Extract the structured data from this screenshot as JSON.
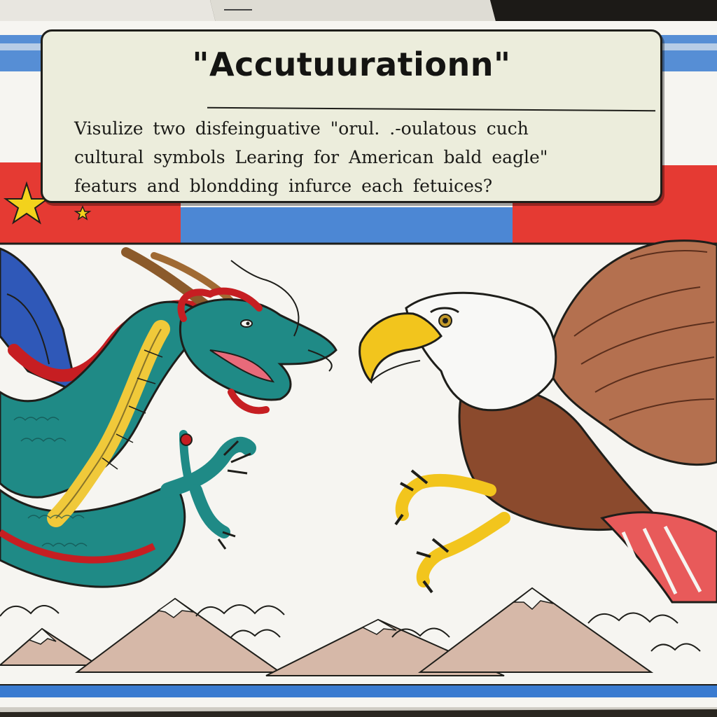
{
  "poster": {
    "title": "\"Accutuurationn\"",
    "lines": [
      "Visulize  two  disfeinguative   \"orul.  .-oulatous  cuch",
      "cultural symbols  Learing   for American  bald eagle\"",
      "featurs   and  blondding   infurce  each  fetuices?"
    ]
  },
  "colors": {
    "paper": "#f6f5f1",
    "flag_red": "#e53a33",
    "flag_blue": "#3a7bd0",
    "star_yellow": "#f3d21c",
    "dragon_teal": "#1f8a86",
    "dragon_belly": "#f0c93a",
    "eagle_brown": "#8b4a2d",
    "beak_yellow": "#f2c51d"
  },
  "icons": [
    "star-icon",
    "dragon-illustration",
    "bald-eagle-illustration",
    "mountain-range",
    "cloud-row"
  ]
}
